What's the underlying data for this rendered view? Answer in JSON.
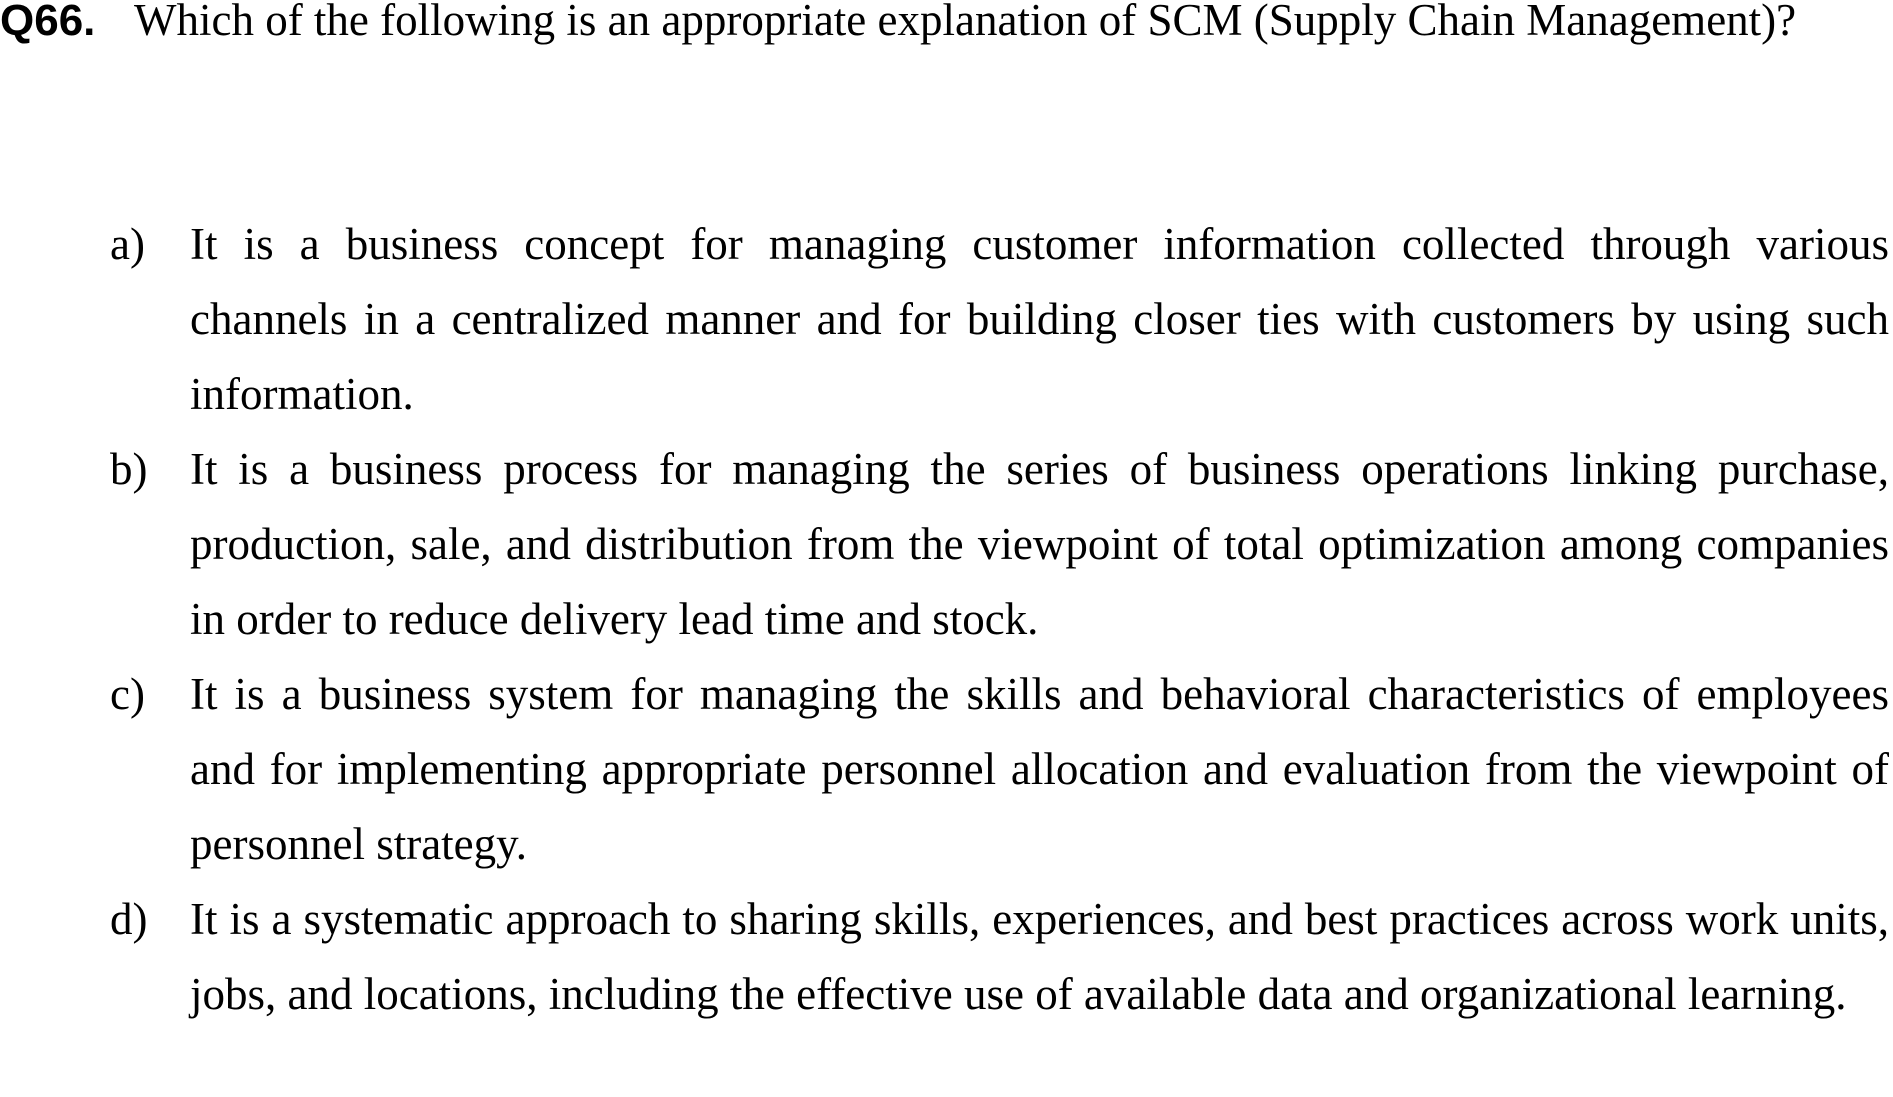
{
  "question": {
    "number": "Q66.",
    "stem": "Which of the following is an appropriate explanation of SCM (Supply Chain Management)?"
  },
  "options": [
    {
      "letter": "a)",
      "text": "It is a business concept for managing customer information collected through various channels in a centralized manner and for building closer ties with customers by using such information."
    },
    {
      "letter": "b)",
      "text": "It is a business process for managing the series of business operations linking purchase, production, sale, and distribution from the viewpoint of total optimization among companies in order to reduce delivery lead time and stock."
    },
    {
      "letter": "c)",
      "text": "It is a business system for managing the skills and behavioral characteristics of employees and for implementing appropriate personnel allocation and evaluation from the viewpoint of personnel strategy."
    },
    {
      "letter": "d)",
      "text": "It is a systematic approach to sharing skills, experiences, and best practices across work units, jobs, and locations, including the effective use of available data and organizational learning."
    }
  ]
}
